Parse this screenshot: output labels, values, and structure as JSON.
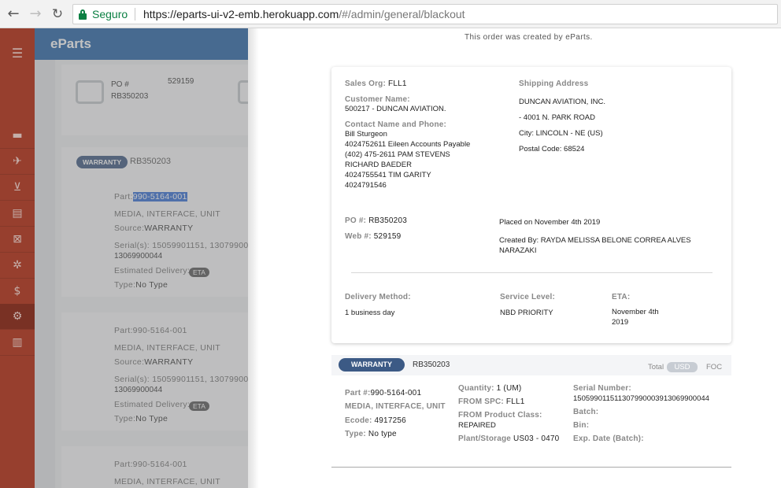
{
  "browser": {
    "secure_label": "Seguro",
    "url_host": "https://eparts-ui-v2-emb.herokuapp.com",
    "url_path": "/#/admin/general/blackout",
    "icons": [
      "back-icon",
      "forward-icon",
      "reload-icon",
      "lock-icon"
    ]
  },
  "sidebar": {
    "icons": [
      "menu-icon",
      "truck-icon",
      "plane-icon",
      "cart-icon",
      "document-icon",
      "box-icon",
      "recycle-icon",
      "dollar-icon",
      "gears-icon",
      "chart-icon"
    ],
    "active_item": "gears-icon"
  },
  "background_page": {
    "logo": "eParts",
    "po_label": "PO #",
    "po_number": "529159",
    "po_ref": "RB350203",
    "warranty_pill": "WARRANTY",
    "warranty_order": "RB350203",
    "items": [
      {
        "part": "Part:990-5164-001",
        "part_prefix": "Part:",
        "part_number": "990-5164-001",
        "description": "MEDIA, INTERFACE, UNIT",
        "source_label": "Source:",
        "source": "WARRANTY",
        "serials_line1": "Serial(s): 15059901151, 13079900",
        "serials_line2": "13069900044",
        "eta_label": "Estimated Delivery:",
        "eta_pill": "ETA",
        "type_label": "Type:",
        "type": "No Type"
      },
      {
        "part": "Part:990-5164-001",
        "description": "MEDIA, INTERFACE, UNIT",
        "source_label": "Source:",
        "source": "WARRANTY",
        "serials_line1": "Serial(s): 15059901151, 13079900",
        "serials_line2": "13069900044",
        "eta_label": "Estimated Delivery:",
        "eta_pill": "ETA",
        "type_label": "Type:",
        "type": "No Type"
      },
      {
        "part": "Part:990-5164-001",
        "description": "MEDIA, INTERFACE, UNIT"
      }
    ]
  },
  "order_panel": {
    "created_note": "This order was created by eParts.",
    "sales_org_label": "Sales Org:",
    "sales_org": "FLL1",
    "customer_name_label": "Customer Name:",
    "customer_name": "500217 - DUNCAN AVIATION.",
    "contact_label": "Contact Name and Phone:",
    "contact_lines": [
      "Bill Sturgeon",
      "4024752611 Eileen Accounts Payable",
      "(402) 475-2611 PAM STEVENS",
      "RICHARD BAEDER",
      "4024755541 TIM GARITY",
      "4024791546"
    ],
    "shipping_label": "Shipping Address",
    "shipping_name": "DUNCAN AVIATION, INC.",
    "shipping_street": "- 4001 N. PARK ROAD",
    "shipping_city": "City: LINCOLN - NE (US)",
    "shipping_postal": "Postal Code: 68524",
    "po_label": "PO #:",
    "po": "RB350203",
    "web_label": "Web #:",
    "web": "529159",
    "placed_on": "Placed on November 4th 2019",
    "created_by": "Created By: RAYDA MELISSA BELONE CORREA ALVES NARAZAKI",
    "delivery_method_label": "Delivery Method:",
    "delivery_method": "1 business day",
    "service_level_label": "Service Level:",
    "service_level": "NBD PRIORITY",
    "eta_label": "ETA:",
    "eta": "November 4th 2019"
  },
  "warranty_bar": {
    "pill": "WARRANTY",
    "order": "RB350203",
    "total_label": "Total",
    "currency": "USD",
    "foc": "FOC"
  },
  "line_item": {
    "part_label": "Part #:",
    "part": "990-5164-001",
    "description": "MEDIA, INTERFACE, UNIT",
    "ecode_label": "Ecode:",
    "ecode": "4917256",
    "type_label": "Type:",
    "type": "No type",
    "quantity_label": "Quantity:",
    "quantity": "1 (UM)",
    "from_spc_label": "FROM SPC:",
    "from_spc": "FLL1",
    "from_product_class_label": "FROM Product Class:",
    "from_product_class": "REPAIRED",
    "plant_storage_label": "Plant/Storage",
    "plant_storage": "US03 - 0470",
    "serial_number_label": "Serial Number:",
    "serial_number": "150599011511307990003913069900044",
    "batch_label": "Batch:",
    "bin_label": "Bin:",
    "exp_date_label": "Exp. Date (Batch):"
  }
}
